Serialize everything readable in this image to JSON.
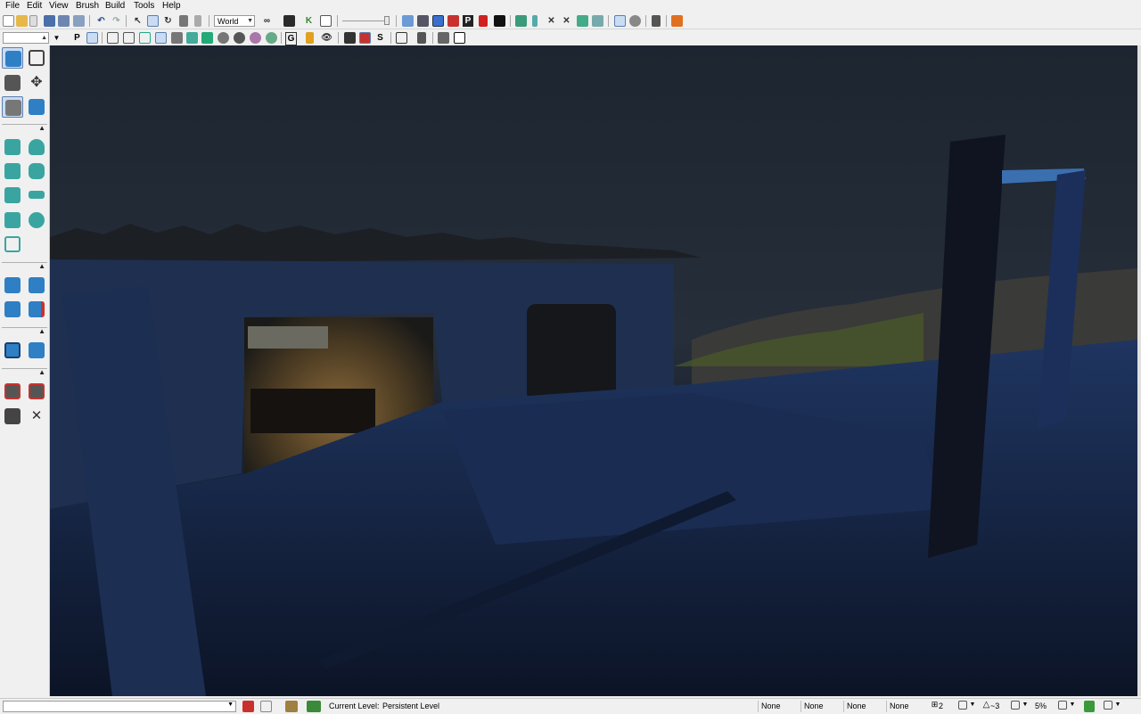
{
  "menu": {
    "items": [
      "File",
      "Edit",
      "View",
      "Brush",
      "Build",
      "Tools",
      "Help"
    ]
  },
  "toolbar1": {
    "coordinate_system": "World"
  },
  "toolbar2": {
    "p_label": "P",
    "g_label": "G",
    "s_label": "S"
  },
  "status": {
    "current_level_label": "Current Level:",
    "current_level_value": "Persistent Level",
    "fields": [
      "None",
      "None",
      "None",
      "None"
    ],
    "grid_value": "2",
    "rotation_value": "~3",
    "scale_value": "5%"
  },
  "colors": {
    "chrome": "#f0f0f0",
    "viewport_sky": "#1f2733",
    "viewport_ground": "#0f1a2b",
    "tool_icon_blue": "#2f7fc4",
    "tool_icon_teal": "#3aa5a0",
    "warm_light": "#b78a44",
    "red_icon": "#c8322e"
  },
  "icons": {
    "left_panel": [
      "open-level-icon",
      "cube-icon",
      "terrain-icon",
      "move-icon",
      "paint-brush-icon",
      "shield-icon",
      "cube-builder-icon",
      "cone-builder-icon",
      "stairs-builder-icon",
      "cylinder-builder-icon",
      "linear-stairs-icon",
      "plane-builder-icon",
      "spiral-stairs-icon",
      "sphere-builder-icon",
      "volumetric-icon",
      "csg-add-icon",
      "csg-subtract-icon",
      "csg-intersect-icon",
      "csg-deintersect-icon",
      "add-volume-icon",
      "add-special-icon",
      "show-selected-icon",
      "hide-selected-icon",
      "select-all-icon",
      "invert-selection-icon"
    ]
  }
}
